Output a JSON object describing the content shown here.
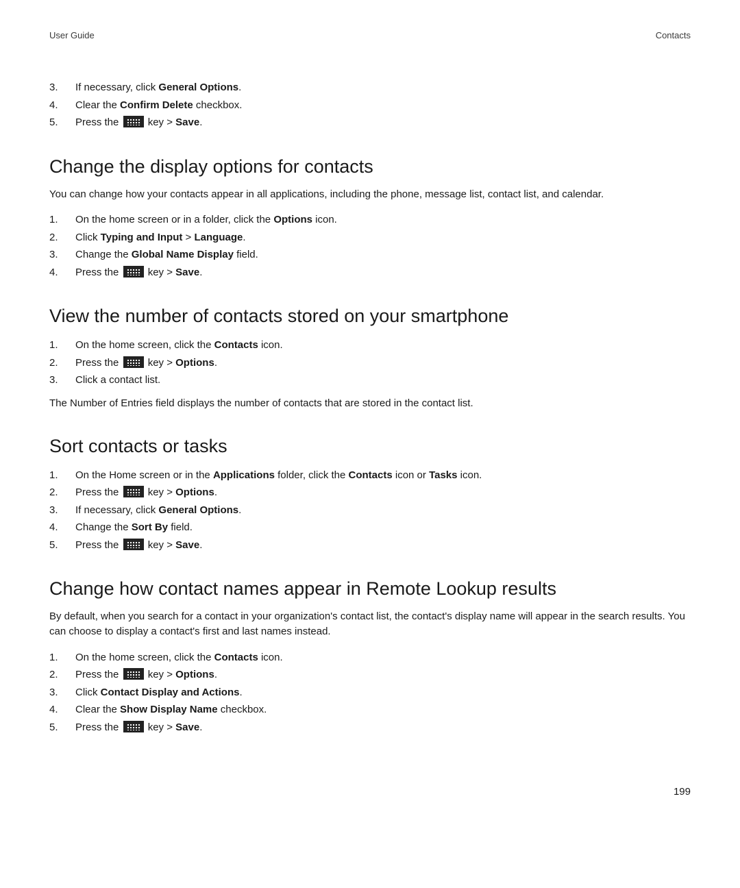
{
  "header": {
    "left": "User Guide",
    "right": "Contacts"
  },
  "page_number": "199",
  "leading_steps": [
    {
      "n": "3.",
      "parts": [
        "If necessary, click ",
        {
          "b": "General Options"
        },
        "."
      ]
    },
    {
      "n": "4.",
      "parts": [
        "Clear the ",
        {
          "b": "Confirm Delete"
        },
        " checkbox."
      ]
    },
    {
      "n": "5.",
      "parts": [
        "Press the ",
        {
          "key": true
        },
        " key > ",
        {
          "b": "Save"
        },
        "."
      ]
    }
  ],
  "sections": [
    {
      "title": "Change the display options for contacts",
      "intro": "You can change how your contacts appear in all applications, including the phone, message list, contact list, and calendar.",
      "steps": [
        {
          "n": "1.",
          "parts": [
            "On the home screen or in a folder, click the ",
            {
              "b": "Options"
            },
            " icon."
          ]
        },
        {
          "n": "2.",
          "parts": [
            "Click ",
            {
              "b": "Typing and Input"
            },
            " > ",
            {
              "b": "Language"
            },
            "."
          ]
        },
        {
          "n": "3.",
          "parts": [
            "Change the ",
            {
              "b": "Global Name Display"
            },
            " field."
          ]
        },
        {
          "n": "4.",
          "parts": [
            "Press the ",
            {
              "key": true
            },
            " key > ",
            {
              "b": "Save"
            },
            "."
          ]
        }
      ]
    },
    {
      "title": "View the number of contacts stored on your smartphone",
      "steps": [
        {
          "n": "1.",
          "parts": [
            "On the home screen, click the ",
            {
              "b": "Contacts"
            },
            " icon."
          ]
        },
        {
          "n": "2.",
          "parts": [
            "Press the ",
            {
              "key": true
            },
            " key > ",
            {
              "b": "Options"
            },
            "."
          ]
        },
        {
          "n": "3.",
          "parts": [
            "Click a contact list."
          ]
        }
      ],
      "outro": "The Number of Entries field displays the number of contacts that are stored in the contact list."
    },
    {
      "title": "Sort contacts or tasks",
      "steps": [
        {
          "n": "1.",
          "parts": [
            "On the Home screen or in the ",
            {
              "b": "Applications"
            },
            " folder, click the ",
            {
              "b": "Contacts"
            },
            " icon or ",
            {
              "b": "Tasks"
            },
            " icon."
          ]
        },
        {
          "n": "2.",
          "parts": [
            "Press the ",
            {
              "key": true
            },
            " key > ",
            {
              "b": "Options"
            },
            "."
          ]
        },
        {
          "n": "3.",
          "parts": [
            "If necessary, click ",
            {
              "b": "General Options"
            },
            "."
          ]
        },
        {
          "n": "4.",
          "parts": [
            "Change the ",
            {
              "b": "Sort By"
            },
            " field."
          ]
        },
        {
          "n": "5.",
          "parts": [
            "Press the ",
            {
              "key": true
            },
            " key > ",
            {
              "b": "Save"
            },
            "."
          ]
        }
      ]
    },
    {
      "title": "Change how contact names appear in Remote Lookup results",
      "intro": "By default, when you search for a contact in your organization's contact list, the contact's display name will appear in the search results. You can choose to display a contact's first and last names instead.",
      "steps": [
        {
          "n": "1.",
          "parts": [
            "On the home screen, click the ",
            {
              "b": "Contacts"
            },
            " icon."
          ]
        },
        {
          "n": "2.",
          "parts": [
            "Press the ",
            {
              "key": true
            },
            " key > ",
            {
              "b": "Options"
            },
            "."
          ]
        },
        {
          "n": "3.",
          "parts": [
            "Click ",
            {
              "b": "Contact Display and Actions"
            },
            "."
          ]
        },
        {
          "n": "4.",
          "parts": [
            "Clear the ",
            {
              "b": "Show Display Name"
            },
            " checkbox."
          ]
        },
        {
          "n": "5.",
          "parts": [
            "Press the ",
            {
              "key": true
            },
            " key > ",
            {
              "b": "Save"
            },
            "."
          ]
        }
      ]
    }
  ]
}
